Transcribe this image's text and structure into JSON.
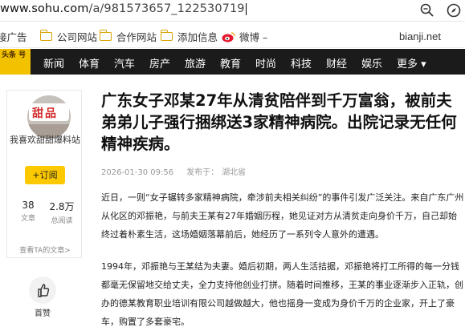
{
  "browser": {
    "url_host": "www.sohu.com",
    "url_path": "/a/981573657_122530719",
    "bookmarks": [
      {
        "label": "接广告"
      },
      {
        "label": "公司网站"
      },
      {
        "label": "合作网站"
      },
      {
        "label": "添加信息"
      },
      {
        "label": "微博 –"
      }
    ],
    "overlay_text": "bianji.net"
  },
  "nav": {
    "logo_text": "头条 号",
    "items": [
      "新闻",
      "体育",
      "汽车",
      "房产",
      "旅游",
      "教育",
      "时尚",
      "科技",
      "财经",
      "娱乐",
      "更多 ▾"
    ]
  },
  "sidebar": {
    "avatar_text": "甜品",
    "author": "我喜欢甜甜爆料站",
    "subscribe": "+订阅",
    "stats": [
      {
        "value": "38",
        "label": "文章"
      },
      {
        "value": "2.8万",
        "label": "总阅读"
      }
    ],
    "more_articles": "查看TA的文章>",
    "like_label": "首赞"
  },
  "article": {
    "title": "广东女子邓某27年从清贫陪伴到千万富翁，被前夫弟弟儿子强行捆绑送3家精神病院。出院记录无任何精神疾病。",
    "date": "2026-01-30 09:56",
    "source_label": "发布于：",
    "location": "湖北省",
    "paragraphs": [
      "近日，一则“女子辗转多家精神病院，牵涉前夫相关纠纷”的事件引发广泛关注。来自广东广州从化区的邓振艳，与前夫王某有27年婚姻历程，她见证对方从清贫走向身价千万，自己却始终过着朴素生活，这场婚姻落幕前后，她经历了一系列令人意外的遭遇。",
      "1994年，邓振艳与王某结为夫妻。婚后初期，两人生活拮据，邓振艳将打工所得的每一分钱都毫无保留地交给丈夫，全力支持他创业打拼。随着时间推移，王某的事业逐渐步入正轨，创办的德某教育职业培训有限公司越做越大，他也摇身一变成为身价千万的企业家，开上了豪车，购置了多套豪宅。"
    ]
  }
}
